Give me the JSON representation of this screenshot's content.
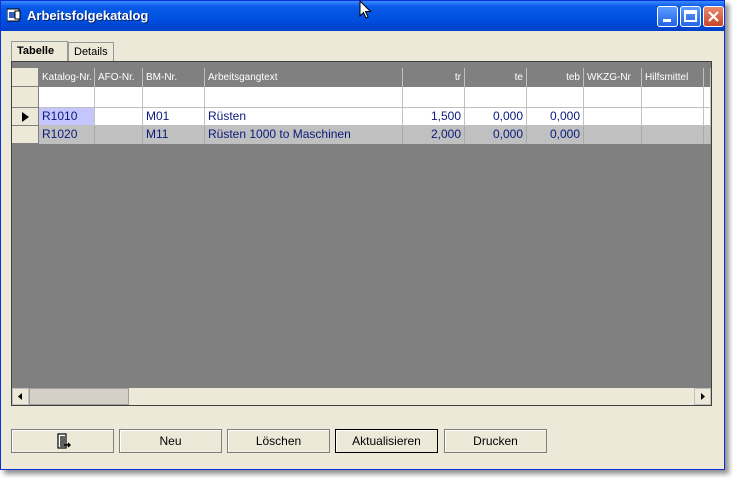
{
  "window": {
    "title": "Arbeitsfolgekatalog"
  },
  "tabs": [
    {
      "label": "Tabelle",
      "active": true
    },
    {
      "label": "Details",
      "active": false
    }
  ],
  "grid": {
    "columns": [
      "Katalog-Nr.",
      "AFO-Nr.",
      "BM-Nr.",
      "Arbeitsgangtext",
      "tr",
      "te",
      "teb",
      "WKZG-Nr",
      "Hilfsmittel"
    ],
    "rows": [
      {
        "katalog": "R1010",
        "afo": "",
        "bm": "M01",
        "text": "Rüsten",
        "tr": "1,500",
        "te": "0,000",
        "teb": "0,000",
        "wkzg": "",
        "hilfsmittel": ""
      },
      {
        "katalog": "R1020",
        "afo": "",
        "bm": "M11",
        "text": "Rüsten 1000 to Maschinen",
        "tr": "2,000",
        "te": "0,000",
        "teb": "0,000",
        "wkzg": "",
        "hilfsmittel": ""
      }
    ]
  },
  "buttons": {
    "neu": "Neu",
    "loeschen": "Löschen",
    "aktualisieren": "Aktualisieren",
    "drucken": "Drucken"
  },
  "icons": {
    "exit": "exit-door-icon",
    "row_indicator": "row-pointer-icon"
  }
}
